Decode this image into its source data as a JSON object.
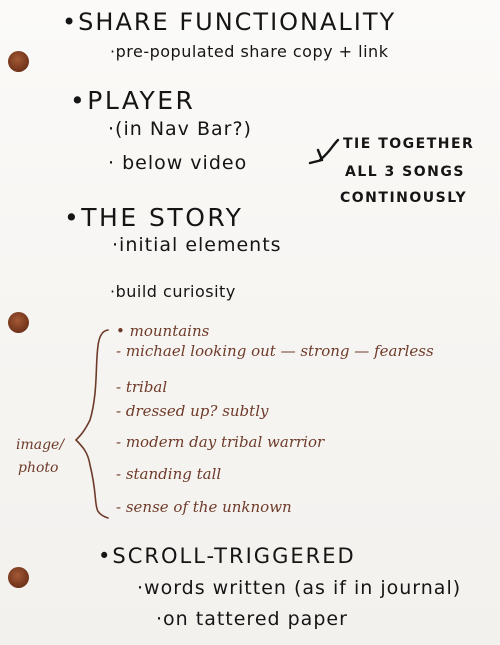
{
  "notes": {
    "share": {
      "heading": "•SHARE FUNCTIONALITY",
      "items": [
        "·pre-populated share copy + link"
      ]
    },
    "player": {
      "heading": "•PLAYER",
      "items": [
        "·(in Nav Bar?)",
        "· below video"
      ],
      "side_note_lines": [
        "TIE TOGETHER",
        "ALL 3 SONGS",
        "CONTINOUSLY"
      ]
    },
    "story": {
      "heading": "•THE STORY",
      "items": [
        "·initial elements",
        "·build curiosity"
      ],
      "sub_items": [
        "• mountains",
        "- michael looking out — strong — fearless",
        "- tribal",
        "- dressed up? subtly",
        "- modern day tribal warrior",
        "- standing tall",
        "- sense of the unknown"
      ],
      "side_label_lines": [
        "image/",
        "photo"
      ]
    },
    "scroll": {
      "heading": "•SCROLL-TRIGGERED",
      "items": [
        "·words written (as if in journal)",
        "·on tattered paper"
      ]
    }
  },
  "colors": {
    "paper": "#f7f5f2",
    "ink_black": "#151515",
    "ink_brown": "#6e3b2a",
    "punch_hole": "#7a3a1f"
  }
}
